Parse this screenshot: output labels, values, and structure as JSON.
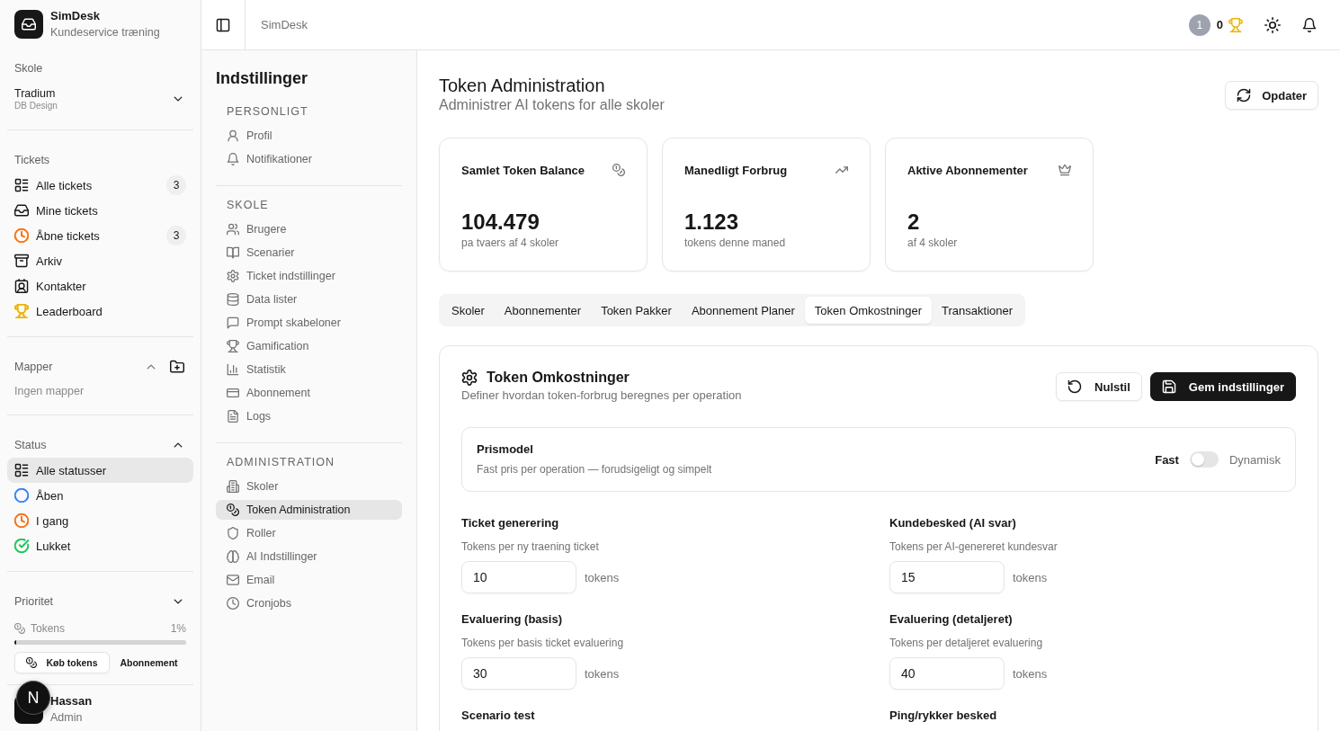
{
  "sidebar": {
    "brand": {
      "name": "SimDesk",
      "tagline": "Kundeservice træning"
    },
    "school": {
      "label": "Skole",
      "name": "Tradium",
      "department": "DB Design"
    },
    "tickets": {
      "label": "Tickets",
      "items": [
        {
          "label": "Alle tickets",
          "count": "3",
          "selected": false
        },
        {
          "label": "Mine tickets",
          "selected": false
        },
        {
          "label": "Åbne tickets",
          "count": "3",
          "color": "#f97316",
          "selected": false
        },
        {
          "label": "Arkiv",
          "selected": false
        },
        {
          "label": "Kontakter",
          "selected": false
        },
        {
          "label": "Leaderboard",
          "color": "#eab308",
          "selected": false
        }
      ]
    },
    "folders": {
      "label": "Mapper",
      "expanded": true,
      "empty_text": "Ingen mapper"
    },
    "status": {
      "label": "Status",
      "expanded": true,
      "items": [
        {
          "label": "Alle statusser",
          "selected": true
        },
        {
          "label": "Åben",
          "color": "#3b82f6",
          "selected": false
        },
        {
          "label": "I gang",
          "color": "#f97316",
          "selected": false
        },
        {
          "label": "Lukket",
          "color": "#22c55e",
          "selected": false
        }
      ]
    },
    "priority": {
      "label": "Prioritet",
      "expanded": false
    },
    "tokens": {
      "label": "Tokens",
      "reading": "1%",
      "level": 0.01
    },
    "buttons": [
      "Køb tokens",
      "Abonnement"
    ],
    "user": {
      "name": "Hassan",
      "role": "Admin"
    },
    "dev_indicator": "N"
  },
  "topbar": {
    "breadcrumb": "SimDesk",
    "badge": "1",
    "points": "0"
  },
  "settings_nav": {
    "title": "Indstillinger",
    "sections": [
      {
        "heading": "PERSONLIGT",
        "items": [
          {
            "label": "Profil",
            "selected": false
          },
          {
            "label": "Notifikationer",
            "selected": false
          }
        ]
      },
      {
        "heading": "SKOLE",
        "items": [
          {
            "label": "Brugere",
            "selected": false
          },
          {
            "label": "Scenarier",
            "selected": false
          },
          {
            "label": "Ticket indstillinger",
            "selected": false
          },
          {
            "label": "Data lister",
            "selected": false
          },
          {
            "label": "Prompt skabeloner",
            "selected": false
          },
          {
            "label": "Gamification",
            "selected": false
          },
          {
            "label": "Statistik",
            "selected": false
          },
          {
            "label": "Abonnement",
            "selected": false
          },
          {
            "label": "Logs",
            "selected": false
          }
        ]
      },
      {
        "heading": "ADMINISTRATION",
        "items": [
          {
            "label": "Skoler",
            "selected": false
          },
          {
            "label": "Token Administration",
            "selected": true
          },
          {
            "label": "Roller",
            "selected": false
          },
          {
            "label": "AI Indstillinger",
            "selected": false
          },
          {
            "label": "Email",
            "selected": false
          },
          {
            "label": "Cronjobs",
            "selected": false
          }
        ]
      }
    ]
  },
  "page": {
    "title": "Token Administration",
    "subtitle": "Administrer AI tokens for alle skoler",
    "refresh_button": "Opdater"
  },
  "stats": [
    {
      "title": "Samlet Token Balance",
      "value": "104.479",
      "note": "pa tvaers af 4 skoler"
    },
    {
      "title": "Manedligt Forbrug",
      "value": "1.123",
      "note": "tokens denne maned"
    },
    {
      "title": "Aktive Abonnementer",
      "value": "2",
      "note": "af 4 skoler"
    }
  ],
  "tabs": [
    {
      "label": "Skoler",
      "selected": false
    },
    {
      "label": "Abonnementer",
      "selected": false
    },
    {
      "label": "Token Pakker",
      "selected": false
    },
    {
      "label": "Abonnement Planer",
      "selected": false
    },
    {
      "label": "Token Omkostninger",
      "selected": true
    },
    {
      "label": "Transaktioner",
      "selected": false
    }
  ],
  "panel": {
    "title": "Token Omkostninger",
    "subtitle": "Definer hvordan token-forbrug beregnes per operation",
    "reset_button": "Nulstil",
    "save_button": "Gem indstillinger",
    "pricing_model": {
      "title": "Prismodel",
      "description": "Fast pris per operation — forudsigeligt og simpelt",
      "left_label": "Fast",
      "right_label": "Dynamisk",
      "on": false
    },
    "fields": [
      {
        "label": "Ticket generering",
        "hint": "Tokens per ny traening ticket",
        "value": "10",
        "unit": "tokens"
      },
      {
        "label": "Kundebesked (AI svar)",
        "hint": "Tokens per AI-genereret kundesvar",
        "value": "15",
        "unit": "tokens"
      },
      {
        "label": "Evaluering (basis)",
        "hint": "Tokens per basis ticket evaluering",
        "value": "30",
        "unit": "tokens"
      },
      {
        "label": "Evaluering (detaljeret)",
        "hint": "Tokens per detaljeret evaluering",
        "value": "40",
        "unit": "tokens"
      },
      {
        "label": "Scenario test"
      },
      {
        "label": "Ping/rykker besked"
      }
    ]
  }
}
